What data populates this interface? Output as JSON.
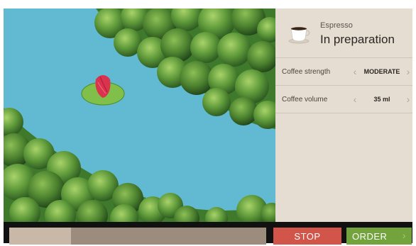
{
  "product": {
    "name": "Espresso",
    "status": "In preparation",
    "icon": "espresso-cup-icon"
  },
  "settings": [
    {
      "label": "Coffee strength",
      "value": "MODERATE"
    },
    {
      "label": "Coffee volume",
      "value": "35 ml"
    }
  ],
  "progress": {
    "percent": 24
  },
  "buttons": {
    "stop": "STOP",
    "order": "ORDER"
  },
  "colors": {
    "panel_bg": "#e6ddd2",
    "stop": "#d2554a",
    "order": "#73a33c",
    "progress_track": "#9c8c7e",
    "progress_fill": "#c9b8a8",
    "water": "#59b6cf",
    "foliage": "#5f9a3a"
  }
}
